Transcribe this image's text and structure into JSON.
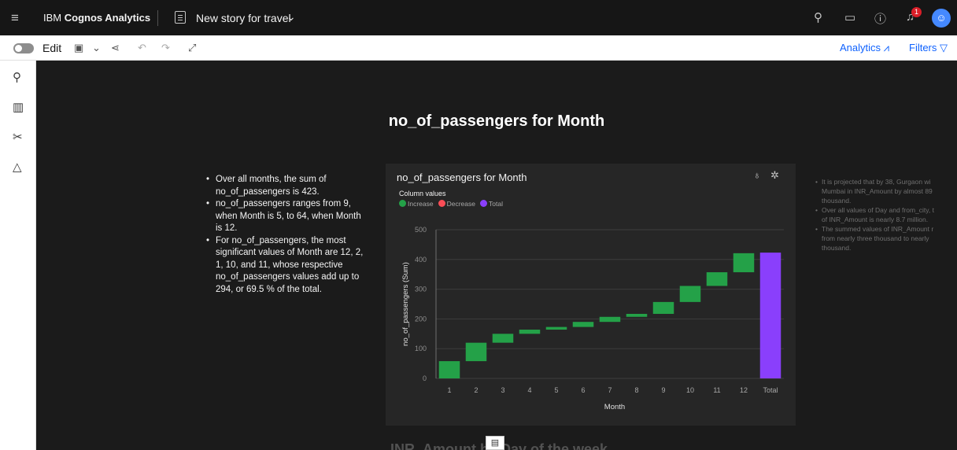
{
  "header": {
    "brand_prefix": "IBM ",
    "brand_name": "Cognos Analytics",
    "story_title": "New story for travel",
    "notification_count": "1"
  },
  "toolbar": {
    "edit_label": "Edit",
    "analytics_label": "Analytics",
    "filters_label": "Filters"
  },
  "page": {
    "heading": "no_of_passengers for Month",
    "bottom_heading": "INR_Amount by Day of the week"
  },
  "insights": [
    "Over all months, the sum of no_of_passengers is 423.",
    "no_of_passengers ranges from 9, when Month is 5, to 64, when Month is 12.",
    "For no_of_passengers, the most significant values of Month are 12, 2, 1, 10, and 11, whose respective no_of_passengers values add up to 294, or 69.5 % of the total."
  ],
  "right_insights": [
    "It is projected that by 38, Gurgaon wi",
    "Mumbai in INR_Amount by almost 89",
    "thousand.",
    "Over all values of Day and from_city, t",
    "of INR_Amount is nearly 8.7 million.",
    "The summed values of INR_Amount r",
    "from nearly three thousand to nearly",
    "thousand."
  ],
  "card": {
    "title": "no_of_passengers for Month",
    "legend_title": "Column values",
    "legend": [
      {
        "label": "Increase",
        "color": "#24a148"
      },
      {
        "label": "Decrease",
        "color": "#fa4d56"
      },
      {
        "label": "Total",
        "color": "#8a3ffc"
      }
    ]
  },
  "chart_data": {
    "type": "bar",
    "subtype": "waterfall",
    "title": "no_of_passengers for Month",
    "xlabel": "Month",
    "ylabel": "no_of_passengers (Sum)",
    "ylim": [
      0,
      500
    ],
    "yticks": [
      0,
      100,
      200,
      300,
      400,
      500
    ],
    "categories": [
      "1",
      "2",
      "3",
      "4",
      "5",
      "6",
      "7",
      "8",
      "9",
      "10",
      "11",
      "12",
      "Total"
    ],
    "values": [
      58,
      62,
      30,
      14,
      9,
      17,
      17,
      10,
      40,
      54,
      46,
      64,
      423
    ],
    "kinds": [
      "increase",
      "increase",
      "increase",
      "increase",
      "increase",
      "increase",
      "increase",
      "increase",
      "increase",
      "increase",
      "increase",
      "increase",
      "total"
    ],
    "colors": {
      "increase": "#24a148",
      "decrease": "#fa4d56",
      "total": "#8a3ffc"
    },
    "grid": true
  }
}
